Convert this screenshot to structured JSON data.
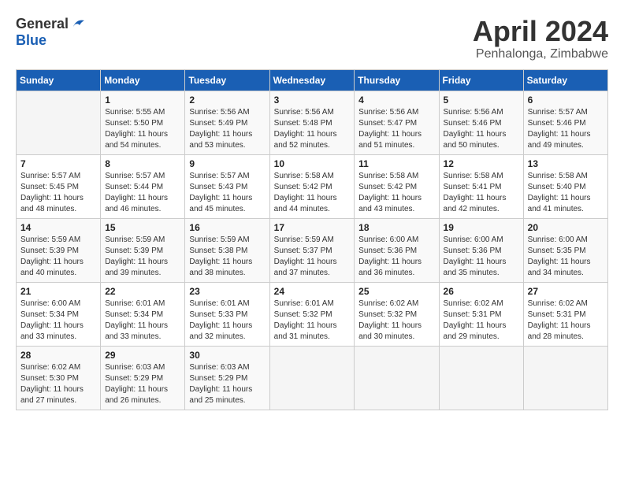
{
  "header": {
    "logo_general": "General",
    "logo_blue": "Blue",
    "month_title": "April 2024",
    "location": "Penhalonga, Zimbabwe"
  },
  "calendar": {
    "days_of_week": [
      "Sunday",
      "Monday",
      "Tuesday",
      "Wednesday",
      "Thursday",
      "Friday",
      "Saturday"
    ],
    "weeks": [
      [
        {
          "day": "",
          "info": ""
        },
        {
          "day": "1",
          "info": "Sunrise: 5:55 AM\nSunset: 5:50 PM\nDaylight: 11 hours\nand 54 minutes."
        },
        {
          "day": "2",
          "info": "Sunrise: 5:56 AM\nSunset: 5:49 PM\nDaylight: 11 hours\nand 53 minutes."
        },
        {
          "day": "3",
          "info": "Sunrise: 5:56 AM\nSunset: 5:48 PM\nDaylight: 11 hours\nand 52 minutes."
        },
        {
          "day": "4",
          "info": "Sunrise: 5:56 AM\nSunset: 5:47 PM\nDaylight: 11 hours\nand 51 minutes."
        },
        {
          "day": "5",
          "info": "Sunrise: 5:56 AM\nSunset: 5:46 PM\nDaylight: 11 hours\nand 50 minutes."
        },
        {
          "day": "6",
          "info": "Sunrise: 5:57 AM\nSunset: 5:46 PM\nDaylight: 11 hours\nand 49 minutes."
        }
      ],
      [
        {
          "day": "7",
          "info": "Sunrise: 5:57 AM\nSunset: 5:45 PM\nDaylight: 11 hours\nand 48 minutes."
        },
        {
          "day": "8",
          "info": "Sunrise: 5:57 AM\nSunset: 5:44 PM\nDaylight: 11 hours\nand 46 minutes."
        },
        {
          "day": "9",
          "info": "Sunrise: 5:57 AM\nSunset: 5:43 PM\nDaylight: 11 hours\nand 45 minutes."
        },
        {
          "day": "10",
          "info": "Sunrise: 5:58 AM\nSunset: 5:42 PM\nDaylight: 11 hours\nand 44 minutes."
        },
        {
          "day": "11",
          "info": "Sunrise: 5:58 AM\nSunset: 5:42 PM\nDaylight: 11 hours\nand 43 minutes."
        },
        {
          "day": "12",
          "info": "Sunrise: 5:58 AM\nSunset: 5:41 PM\nDaylight: 11 hours\nand 42 minutes."
        },
        {
          "day": "13",
          "info": "Sunrise: 5:58 AM\nSunset: 5:40 PM\nDaylight: 11 hours\nand 41 minutes."
        }
      ],
      [
        {
          "day": "14",
          "info": "Sunrise: 5:59 AM\nSunset: 5:39 PM\nDaylight: 11 hours\nand 40 minutes."
        },
        {
          "day": "15",
          "info": "Sunrise: 5:59 AM\nSunset: 5:39 PM\nDaylight: 11 hours\nand 39 minutes."
        },
        {
          "day": "16",
          "info": "Sunrise: 5:59 AM\nSunset: 5:38 PM\nDaylight: 11 hours\nand 38 minutes."
        },
        {
          "day": "17",
          "info": "Sunrise: 5:59 AM\nSunset: 5:37 PM\nDaylight: 11 hours\nand 37 minutes."
        },
        {
          "day": "18",
          "info": "Sunrise: 6:00 AM\nSunset: 5:36 PM\nDaylight: 11 hours\nand 36 minutes."
        },
        {
          "day": "19",
          "info": "Sunrise: 6:00 AM\nSunset: 5:36 PM\nDaylight: 11 hours\nand 35 minutes."
        },
        {
          "day": "20",
          "info": "Sunrise: 6:00 AM\nSunset: 5:35 PM\nDaylight: 11 hours\nand 34 minutes."
        }
      ],
      [
        {
          "day": "21",
          "info": "Sunrise: 6:00 AM\nSunset: 5:34 PM\nDaylight: 11 hours\nand 33 minutes."
        },
        {
          "day": "22",
          "info": "Sunrise: 6:01 AM\nSunset: 5:34 PM\nDaylight: 11 hours\nand 33 minutes."
        },
        {
          "day": "23",
          "info": "Sunrise: 6:01 AM\nSunset: 5:33 PM\nDaylight: 11 hours\nand 32 minutes."
        },
        {
          "day": "24",
          "info": "Sunrise: 6:01 AM\nSunset: 5:32 PM\nDaylight: 11 hours\nand 31 minutes."
        },
        {
          "day": "25",
          "info": "Sunrise: 6:02 AM\nSunset: 5:32 PM\nDaylight: 11 hours\nand 30 minutes."
        },
        {
          "day": "26",
          "info": "Sunrise: 6:02 AM\nSunset: 5:31 PM\nDaylight: 11 hours\nand 29 minutes."
        },
        {
          "day": "27",
          "info": "Sunrise: 6:02 AM\nSunset: 5:31 PM\nDaylight: 11 hours\nand 28 minutes."
        }
      ],
      [
        {
          "day": "28",
          "info": "Sunrise: 6:02 AM\nSunset: 5:30 PM\nDaylight: 11 hours\nand 27 minutes."
        },
        {
          "day": "29",
          "info": "Sunrise: 6:03 AM\nSunset: 5:29 PM\nDaylight: 11 hours\nand 26 minutes."
        },
        {
          "day": "30",
          "info": "Sunrise: 6:03 AM\nSunset: 5:29 PM\nDaylight: 11 hours\nand 25 minutes."
        },
        {
          "day": "",
          "info": ""
        },
        {
          "day": "",
          "info": ""
        },
        {
          "day": "",
          "info": ""
        },
        {
          "day": "",
          "info": ""
        }
      ]
    ]
  }
}
